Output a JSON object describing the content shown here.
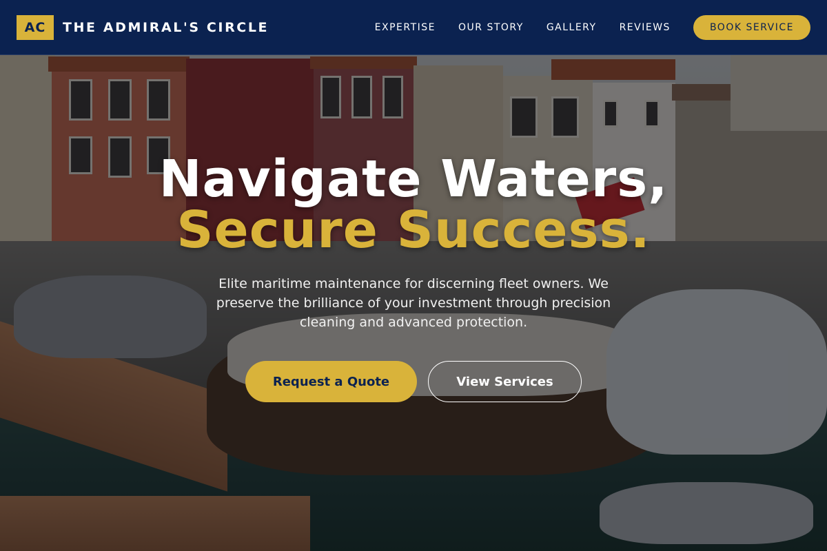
{
  "header": {
    "logo_mark": "AC",
    "brand_name": "THE ADMIRAL'S CIRCLE",
    "nav": [
      {
        "label": "EXPERTISE"
      },
      {
        "label": "OUR STORY"
      },
      {
        "label": "GALLERY"
      },
      {
        "label": "REVIEWS"
      }
    ],
    "cta_label": "BOOK SERVICE"
  },
  "hero": {
    "headline_line1": "Navigate Waters,",
    "headline_line2": "Secure Success.",
    "subtitle": "Elite maritime maintenance for discerning fleet owners. We preserve the brilliance of your investment through precision cleaning and advanced protection.",
    "primary_cta": "Request a Quote",
    "secondary_cta": "View Services",
    "background_image": "marina-harbor-boats-photo"
  },
  "colors": {
    "navy": "#0b2250",
    "gold": "#d9b33a",
    "white": "#ffffff"
  }
}
